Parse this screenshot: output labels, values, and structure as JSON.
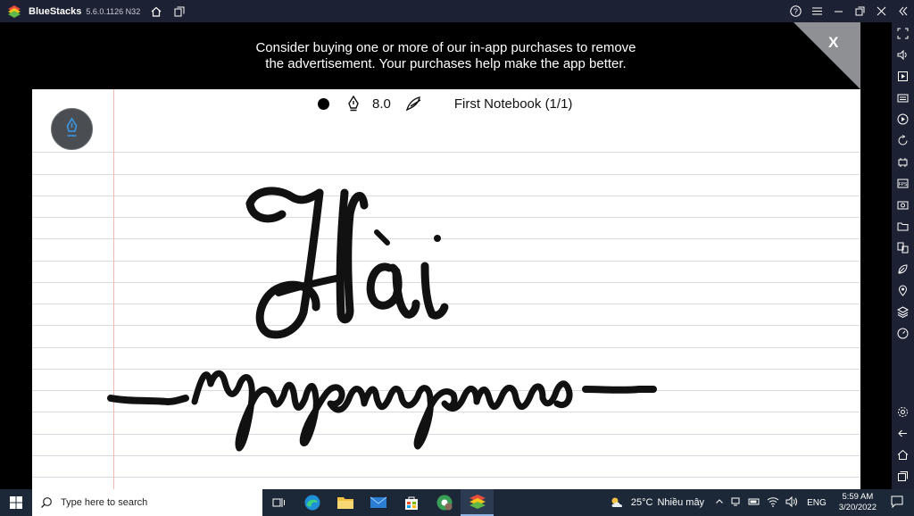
{
  "window": {
    "app_name": "BlueStacks",
    "version": "5.6.0.1126 N32"
  },
  "ad": {
    "line1": "Consider buying one or more of our in-app purchases to remove",
    "line2": "the advertisement. Your purchases help make the app better.",
    "close_label": "X"
  },
  "notebook": {
    "pen_size": "8.0",
    "title": "First Notebook (1/1)"
  },
  "taskbar": {
    "search_placeholder": "Type here to search",
    "weather_temp": "25°C",
    "weather_text": "Nhiều mây",
    "language": "ENG",
    "time": "5:59 AM",
    "date": "3/20/2022"
  }
}
